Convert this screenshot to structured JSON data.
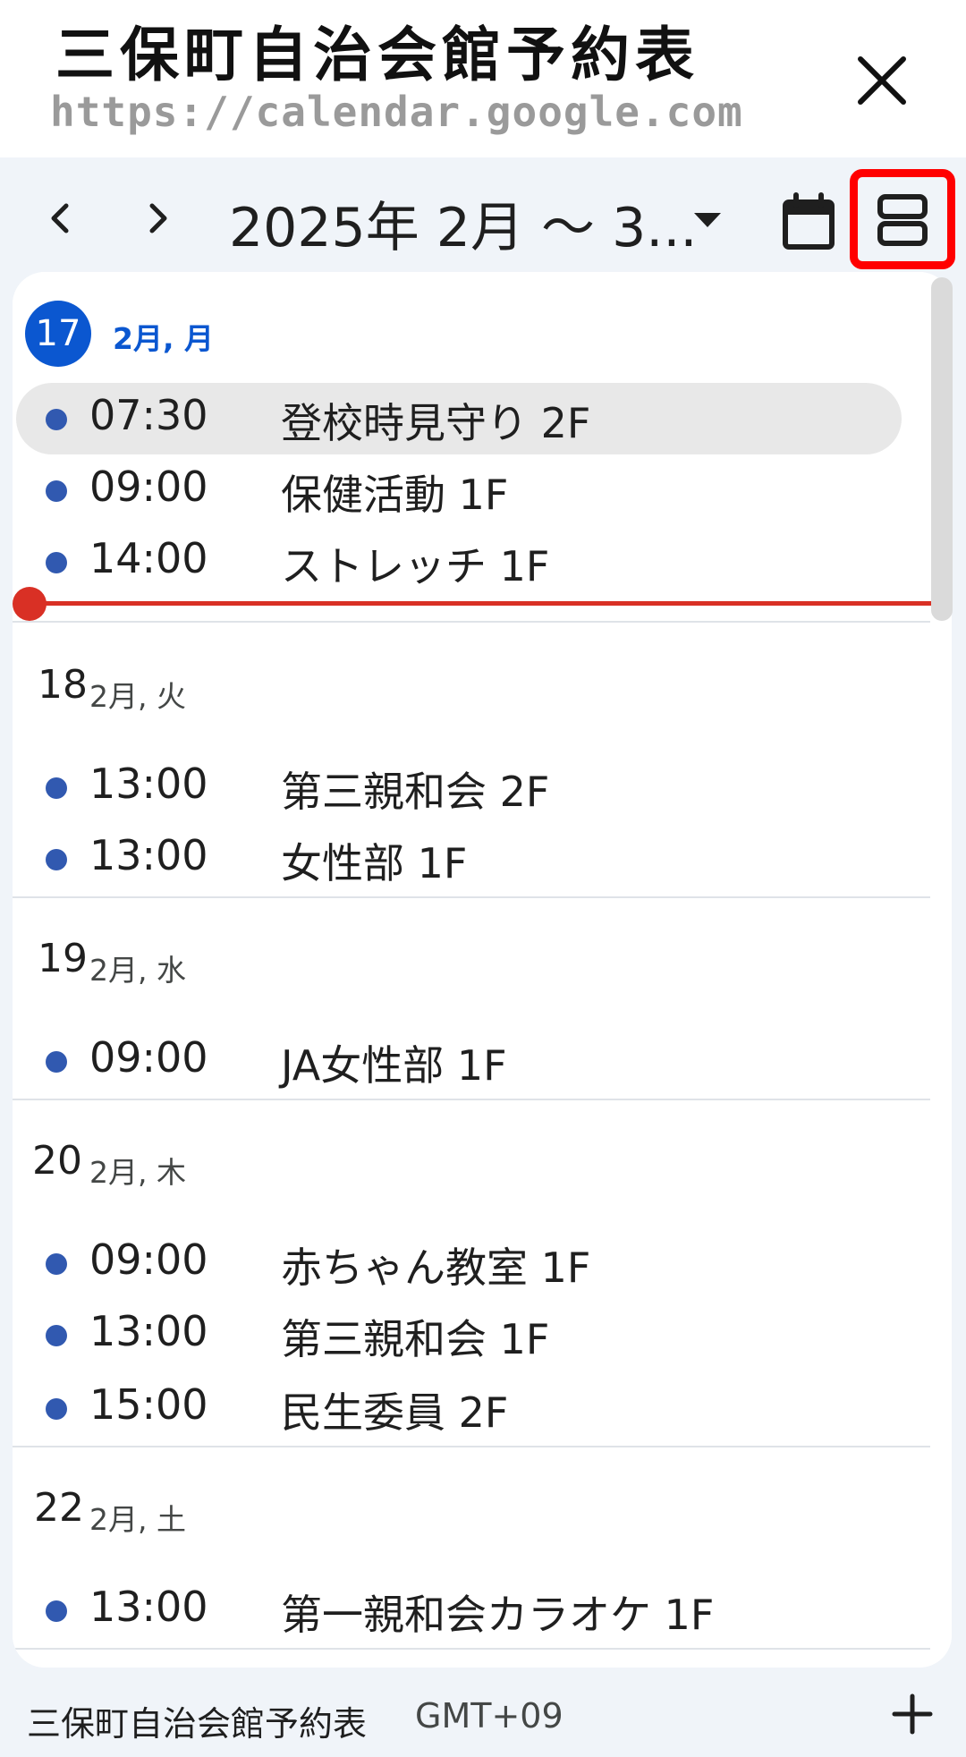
{
  "header": {
    "title": "三保町自治会館予約表",
    "url": "https://calendar.google.com"
  },
  "toolbar": {
    "date_range": "2025年 2月 ～ 3...",
    "icons": {
      "prev": "chevron-left-icon",
      "next": "chevron-right-icon",
      "dropdown": "caret-down-icon",
      "month": "calendar-icon",
      "schedule": "agenda-view-icon"
    },
    "highlight_color": "#ff0000"
  },
  "days": [
    {
      "num": "17",
      "label": "2月, 月",
      "today": true,
      "events": [
        {
          "time": "07:30",
          "title": "登校時見守り 2F"
        },
        {
          "time": "09:00",
          "title": "保健活動 1F"
        },
        {
          "time": "14:00",
          "title": "ストレッチ 1F"
        }
      ]
    },
    {
      "num": "18",
      "label": "2月, 火",
      "events": [
        {
          "time": "13:00",
          "title": "第三親和会 2F"
        },
        {
          "time": "13:00",
          "title": "女性部 1F"
        }
      ]
    },
    {
      "num": "19",
      "label": "2月, 水",
      "events": [
        {
          "time": "09:00",
          "title": "JA女性部 1F"
        }
      ]
    },
    {
      "num": "20",
      "label": "2月, 木",
      "events": [
        {
          "time": "09:00",
          "title": "赤ちゃん教室 1F"
        },
        {
          "time": "13:00",
          "title": "第三親和会 1F"
        },
        {
          "time": "15:00",
          "title": "民生委員 2F"
        }
      ]
    },
    {
      "num": "22",
      "label": "2月, 土",
      "events": [
        {
          "time": "13:00",
          "title": "第一親和会カラオケ 1F"
        }
      ]
    }
  ],
  "footer": {
    "calendar_name": "三保町自治会館予約表",
    "timezone": "GMT+09"
  },
  "colors": {
    "accent": "#0b57d0",
    "event_dot": "#3159b0",
    "now_line": "#d93025"
  }
}
